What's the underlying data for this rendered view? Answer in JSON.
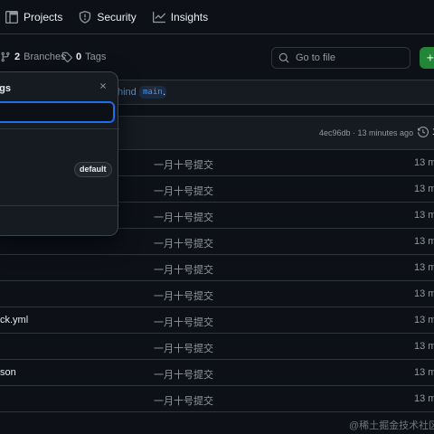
{
  "nav": {
    "tabs": [
      {
        "label": "Projects",
        "icon": "table-icon"
      },
      {
        "label": "Security",
        "icon": "shield-icon"
      },
      {
        "label": "Insights",
        "icon": "graph-icon"
      }
    ]
  },
  "toolbar": {
    "branches_count": "2",
    "branches_label": "Branches",
    "tags_count": "0",
    "tags_label": "Tags",
    "search_placeholder": "Go to file"
  },
  "banner": {
    "text": "hind",
    "branch": "main",
    "suffix": "."
  },
  "commit": {
    "hash_time": "4ec96db · 13 minutes ago",
    "history_label": "1"
  },
  "files": [
    {
      "name": "",
      "message": "一月十号提交",
      "date": "13 m"
    },
    {
      "name": "",
      "message": "一月十号提交",
      "date": "13 m"
    },
    {
      "name": "",
      "message": "一月十号提交",
      "date": "13 m"
    },
    {
      "name": "",
      "message": "一月十号提交",
      "date": "13 m"
    },
    {
      "name": "",
      "message": "一月十号提交",
      "date": "13 m"
    },
    {
      "name": "",
      "message": "一月十号提交",
      "date": "13 m"
    },
    {
      "name": "ck.yml",
      "message": "一月十号提交",
      "date": "13 m"
    },
    {
      "name": "",
      "message": "一月十号提交",
      "date": "13 m"
    },
    {
      "name": "son",
      "message": "一月十号提交",
      "date": "13 m"
    },
    {
      "name": "",
      "message": "一月十号提交",
      "date": "13 m"
    }
  ],
  "popover": {
    "title": "ags",
    "input_value": "",
    "default_badge": "default"
  },
  "watermark": "@稀土掘金技术社区",
  "colors": {
    "background": "#0d1117",
    "border": "#30363d",
    "accent": "#4493f8",
    "green": "#238636",
    "muted": "#9198a1"
  }
}
